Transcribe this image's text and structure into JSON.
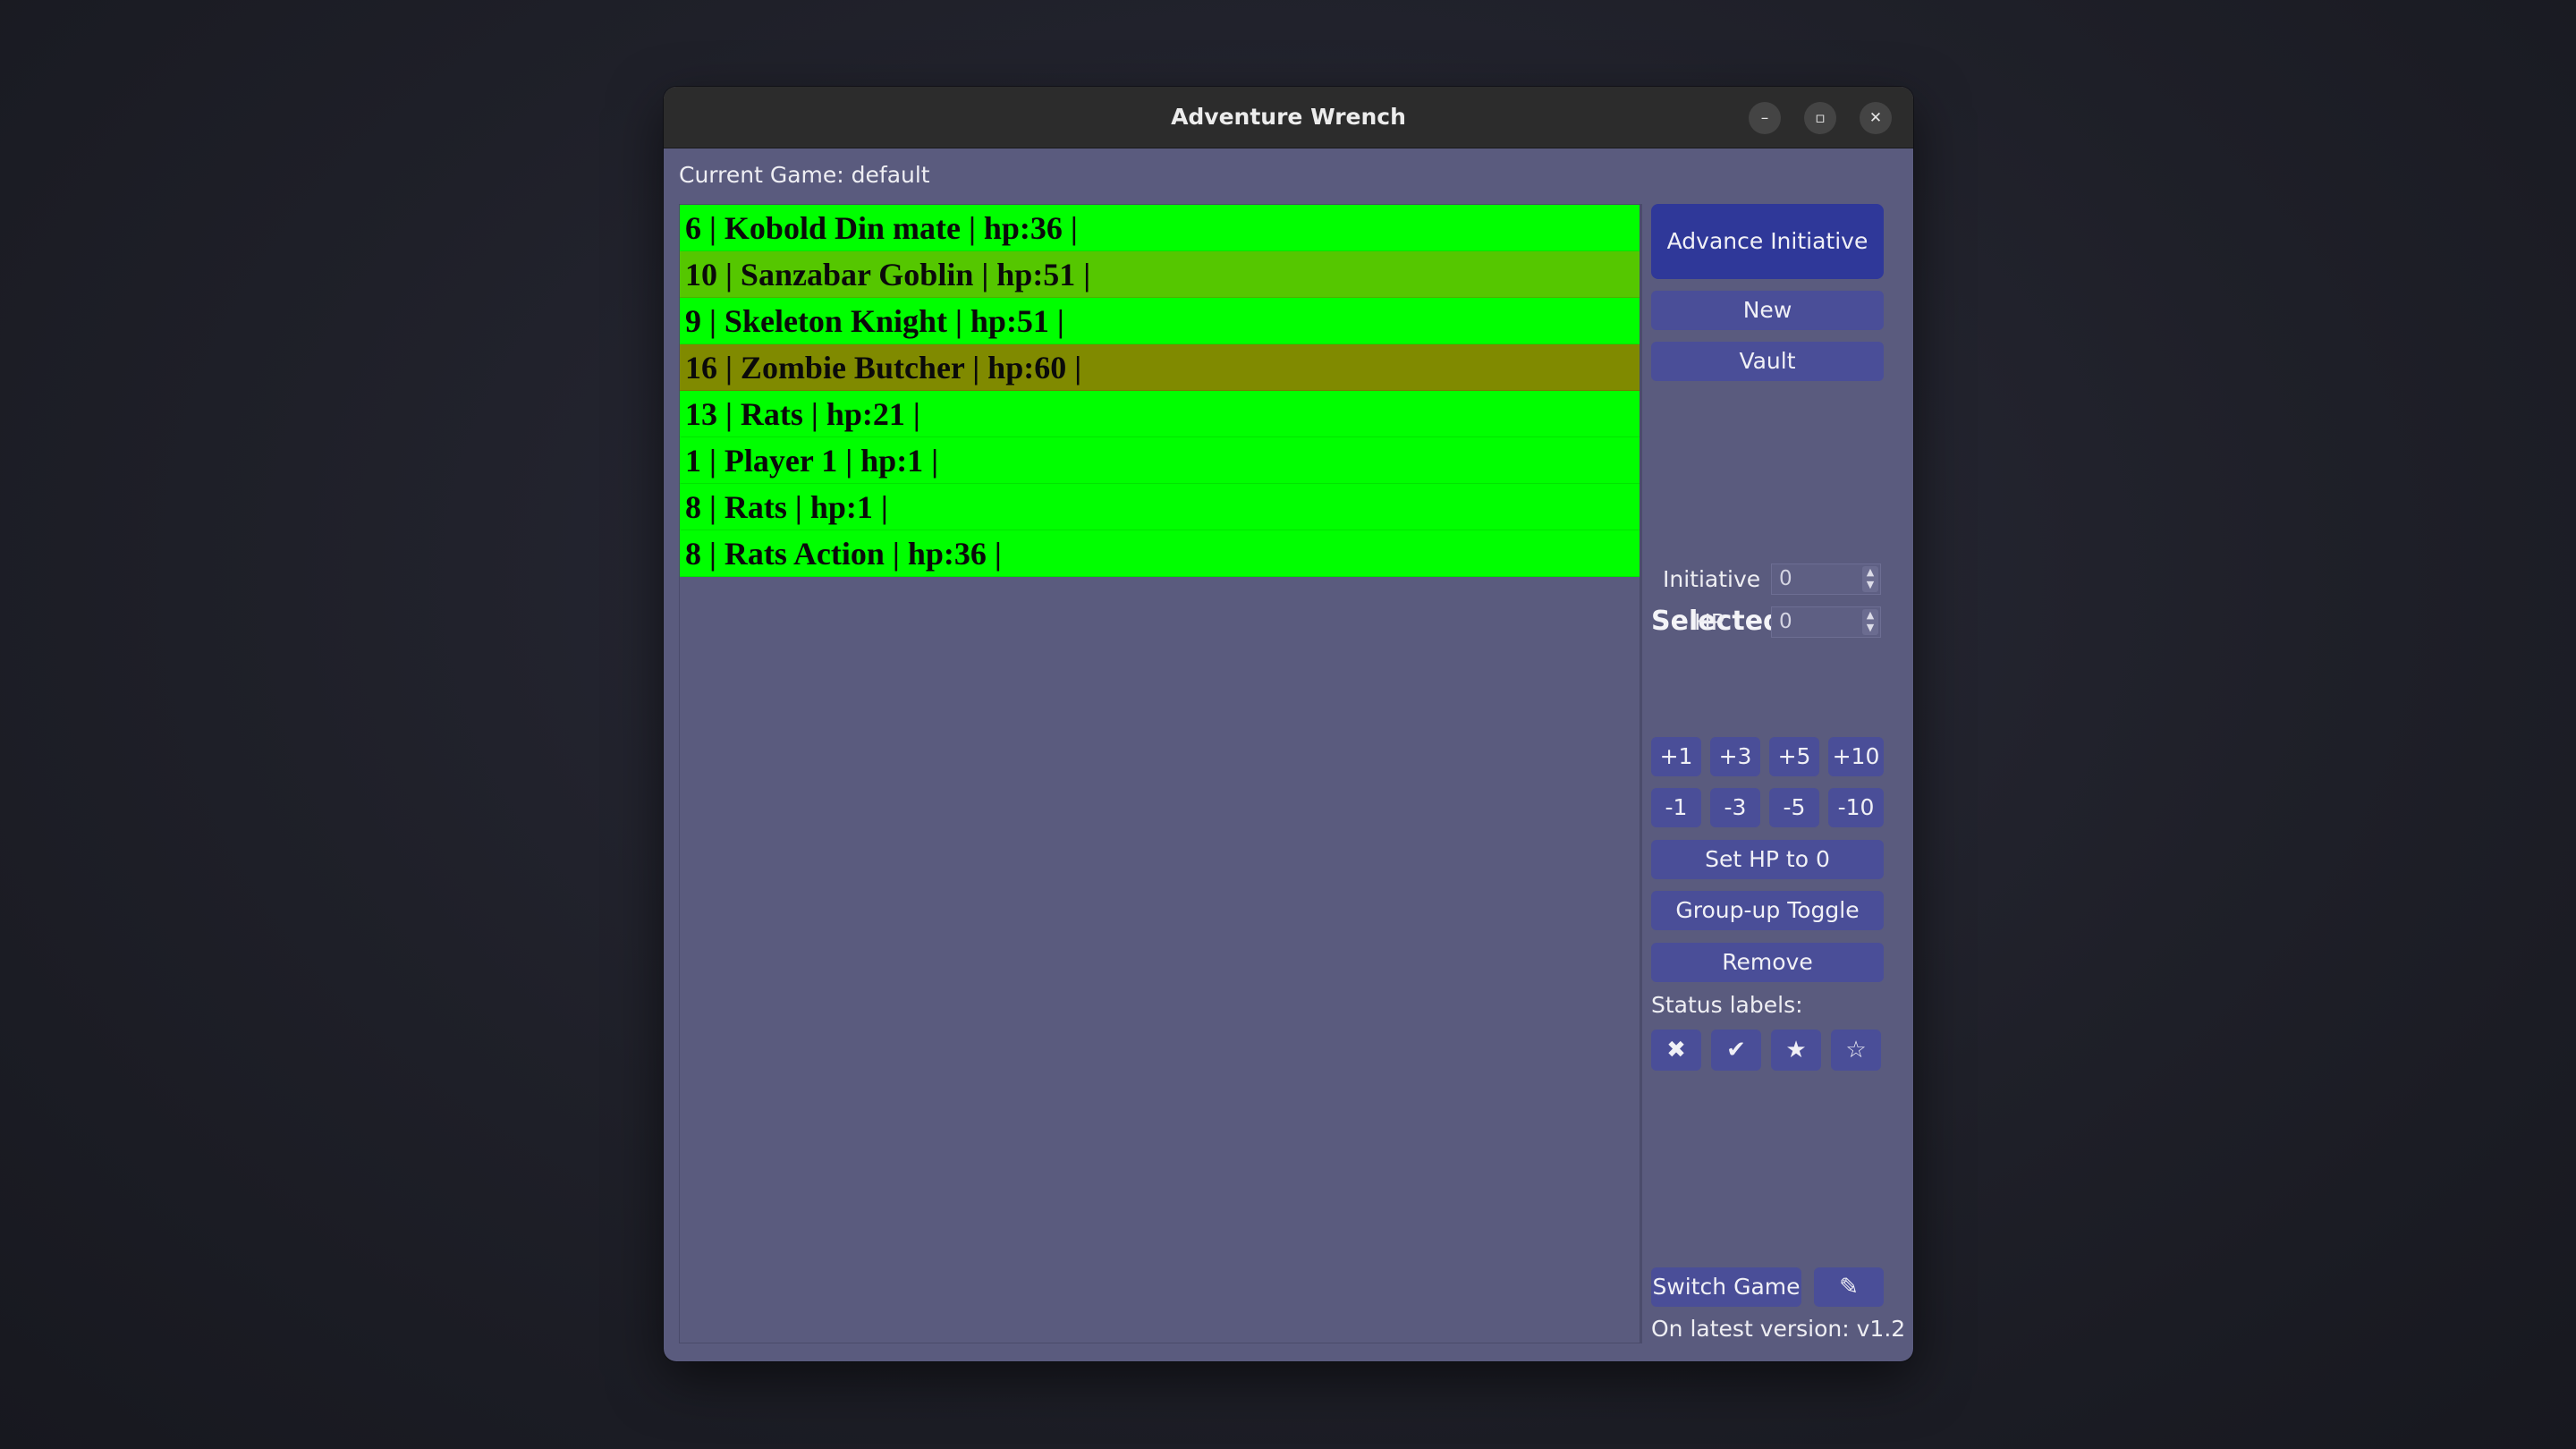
{
  "window": {
    "title": "Adventure Wrench"
  },
  "current_game": "Current Game: default",
  "initiative_list": [
    {
      "text": "6 | Kobold Din mate | hp:36 |",
      "color": "#00ff00"
    },
    {
      "text": "10 | Sanzabar Goblin | hp:51 |",
      "color": "#55c700"
    },
    {
      "text": "9 | Skeleton Knight | hp:51 |",
      "color": "#00ff00"
    },
    {
      "text": "16 | Zombie Butcher | hp:60 |",
      "color": "#808a00"
    },
    {
      "text": "13 | Rats | hp:21 |",
      "color": "#00ff00"
    },
    {
      "text": "1 | Player 1 | hp:1 |",
      "color": "#00ff00"
    },
    {
      "text": "8 | Rats | hp:1 |",
      "color": "#00ff00"
    },
    {
      "text": "8 | Rats Action | hp:36 |",
      "color": "#00ff00"
    }
  ],
  "buttons": {
    "advance_initiative": "Advance Initiative",
    "new": "New",
    "vault": "Vault",
    "set_hp_zero": "Set HP to 0",
    "group_up_toggle": "Group-up Toggle",
    "remove": "Remove",
    "switch_game": "Switch Game"
  },
  "selected_item": {
    "heading": "Selected Item:",
    "initiative_label": "Initiative",
    "initiative_value": "0",
    "hp_label": "HP",
    "hp_value": "0"
  },
  "hp_plus": [
    "+1",
    "+3",
    "+5",
    "+10"
  ],
  "hp_minus": [
    "-1",
    "-3",
    "-5",
    "-10"
  ],
  "status_labels_title": "Status labels:",
  "status_icons": [
    {
      "glyph": "✖",
      "name": "cross-mark"
    },
    {
      "glyph": "✔",
      "name": "check-mark"
    },
    {
      "glyph": "★",
      "name": "filled-star"
    },
    {
      "glyph": "☆",
      "name": "outline-star"
    }
  ],
  "edit_icon": "✎",
  "version": "On latest version: v1.2",
  "colors": {
    "window_bg": "#5a5b7e",
    "button_bg": "#4a4e98",
    "primary_button_bg": "#2f3899"
  }
}
